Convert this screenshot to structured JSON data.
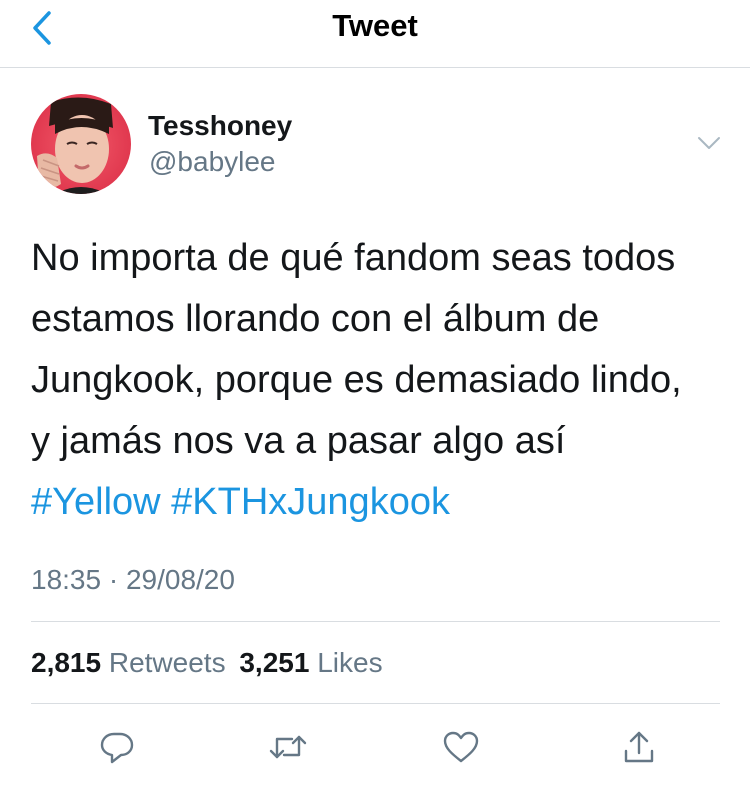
{
  "nav": {
    "title": "Tweet",
    "back_icon": "chevron-left-icon"
  },
  "user": {
    "display_name": "Tesshoney",
    "handle": "@babylee",
    "avatar": "avatar-photo"
  },
  "tweet": {
    "lines": [
      "No importa de qué fandom seas todos",
      "estamos llorando con el álbum de",
      "Jungkook, porque es demasiado lindo,",
      "y jamás nos va a pasar algo así"
    ],
    "hashtags": [
      "#Yellow",
      "#KTHxJungkook"
    ],
    "timestamp": "18:35 · 29/08/20"
  },
  "stats": {
    "retweets_count": "2,815",
    "retweets_label": "Retweets",
    "likes_count": "3,251",
    "likes_label": "Likes"
  },
  "actions": [
    "reply-icon",
    "retweet-icon",
    "like-icon",
    "share-icon"
  ],
  "colors": {
    "accent": "#1b95e0",
    "secondary_text": "#657786",
    "divider": "#d9dde1"
  }
}
